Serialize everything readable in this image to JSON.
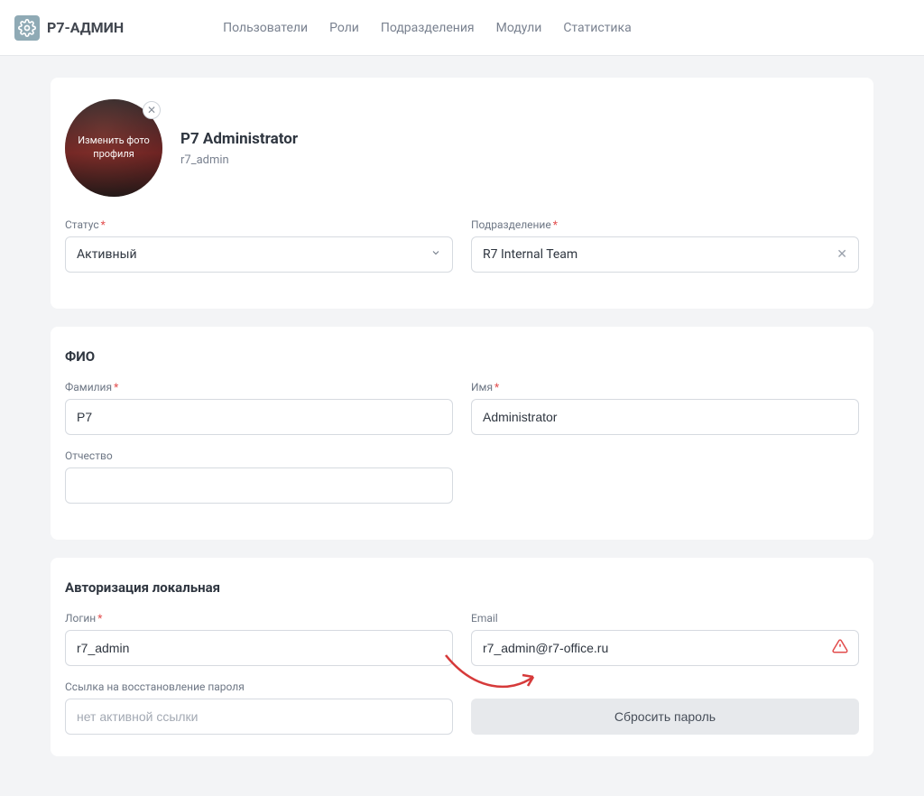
{
  "header": {
    "logo_text": "Р7-АДМИН",
    "nav": {
      "users": "Пользователи",
      "roles": "Роли",
      "departments": "Подразделения",
      "modules": "Модули",
      "stats": "Статистика"
    }
  },
  "profile": {
    "avatar_overlay": "Изменить фото профиля",
    "display_name": "P7 Administrator",
    "username": "r7_admin"
  },
  "status": {
    "label": "Статус",
    "value": "Активный"
  },
  "department": {
    "label": "Подразделение",
    "value": "R7 Internal Team"
  },
  "fio_section_title": "ФИО",
  "lastname": {
    "label": "Фамилия",
    "value": "P7"
  },
  "firstname": {
    "label": "Имя",
    "value": "Administrator"
  },
  "patronymic": {
    "label": "Отчество",
    "value": ""
  },
  "auth_section_title": "Авторизация локальная",
  "login": {
    "label": "Логин",
    "value": "r7_admin"
  },
  "email": {
    "label": "Email",
    "value": "r7_admin@r7-office.ru"
  },
  "reset_link": {
    "label": "Ссылка на восстановление пароля",
    "placeholder": "нет активной ссылки"
  },
  "reset_button": "Сбросить пароль"
}
